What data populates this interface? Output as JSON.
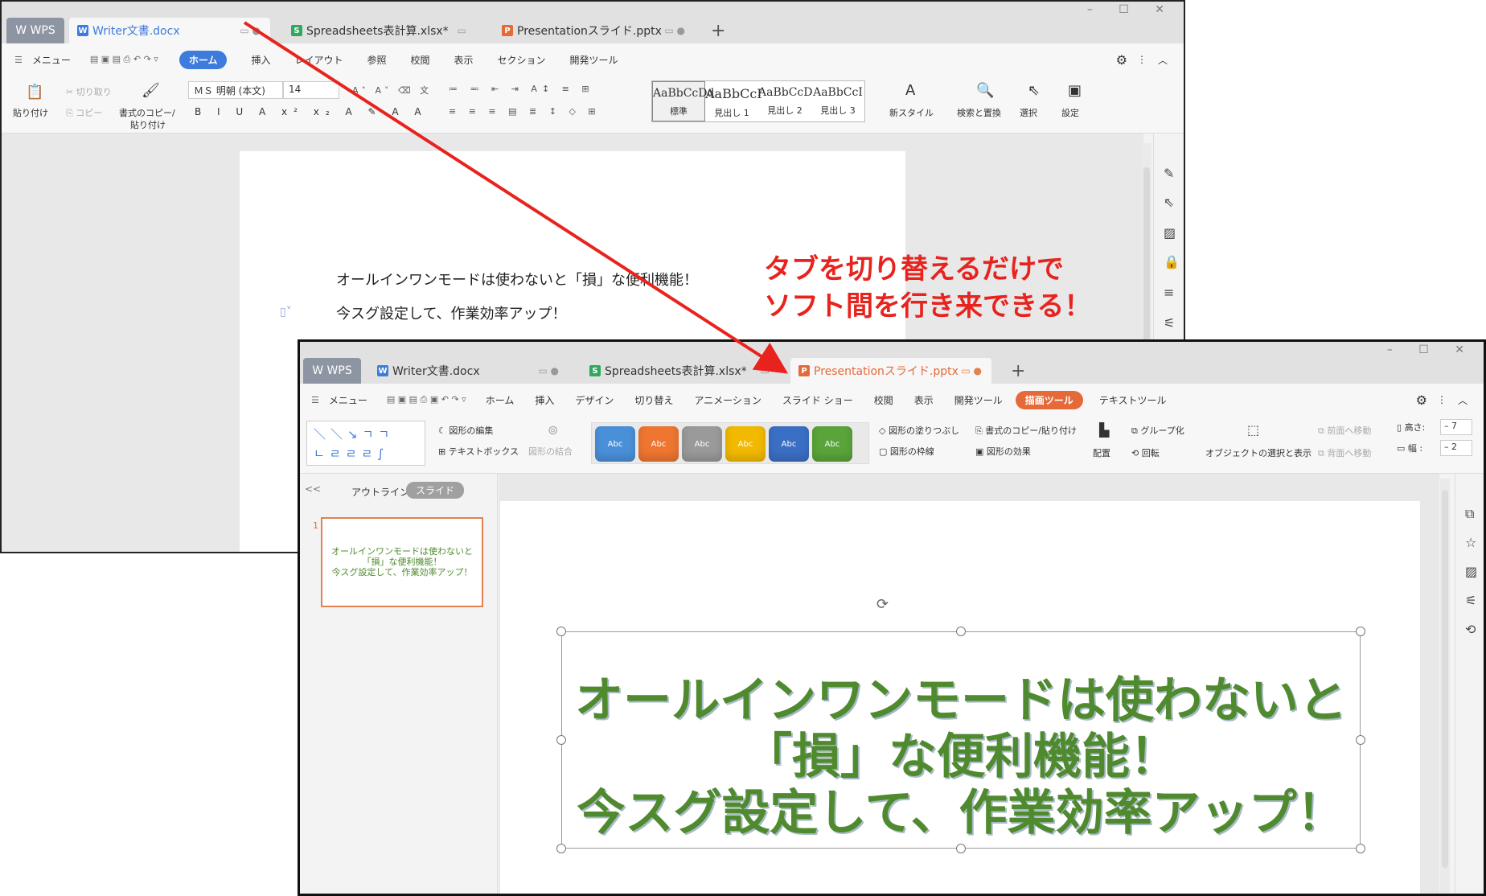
{
  "callout": {
    "line1": "タブを切り替えるだけで",
    "line2": "ソフト間を行き来できる！"
  },
  "writer": {
    "wps_label": "W WPS",
    "tabs": [
      {
        "label": "Writer文書.docx",
        "icon": "W"
      },
      {
        "label": "Spreadsheets表計算.xlsx*",
        "icon": "S"
      },
      {
        "label": "Presentationスライド.pptx",
        "icon": "P"
      }
    ],
    "menu_label": "メニュー",
    "menu": [
      "ホーム",
      "挿入",
      "レイアウト",
      "参照",
      "校閲",
      "表示",
      "セクション",
      "開発ツール"
    ],
    "ribbon": {
      "paste": "貼り付け",
      "cut": "切り取り",
      "copy": "コピー",
      "format_painter_1": "書式のコピー/",
      "format_painter_2": "貼り付け",
      "font_name": "ＭＳ 明朝 (本文)",
      "font_size": "14",
      "styles": [
        {
          "preview": "AaBbCcDd",
          "label": "標準"
        },
        {
          "preview": "AaBbCcI",
          "label": "見出し 1"
        },
        {
          "preview": "AaBbCcD",
          "label": "見出し 2"
        },
        {
          "preview": "AaBbCcI",
          "label": "見出し 3"
        }
      ],
      "new_style": "新スタイル",
      "find_replace": "検索と置換",
      "select": "選択",
      "settings": "設定"
    },
    "doc_lines": [
      "オールインワンモードは使わないと「損」な便利機能！",
      "今スグ設定して、作業効率アップ！"
    ]
  },
  "presentation": {
    "wps_label": "W WPS",
    "tabs": [
      {
        "label": "Writer文書.docx",
        "icon": "W"
      },
      {
        "label": "Spreadsheets表計算.xlsx*",
        "icon": "S"
      },
      {
        "label": "Presentationスライド.pptx",
        "icon": "P"
      }
    ],
    "menu_label": "メニュー",
    "menu": [
      "ホーム",
      "挿入",
      "デザイン",
      "切り替え",
      "アニメーション",
      "スライド ショー",
      "校閲",
      "表示",
      "開発ツール",
      "描画ツール",
      "テキストツール"
    ],
    "ribbon": {
      "edit_shape": "図形の編集",
      "text_box": "テキストボックス",
      "merge_shapes": "図形の結合",
      "shape_style_label": "Abc",
      "fill": "図形の塗りつぶし",
      "outline": "図形の枠線",
      "copy_format": "書式のコピー/貼り付け",
      "effect": "図形の効果",
      "arrange": "配置",
      "group": "グループ化",
      "rotate": "回転",
      "select_pane": "オブジェクトの選択と表示",
      "bring_forward": "前面へ移動",
      "send_backward": "背面へ移動",
      "height_label": "高さ:",
      "width_label": "幅 :",
      "height_value": "7",
      "width_value": "2"
    },
    "panel_tabs": {
      "outline": "アウトライン",
      "slides": "スライド"
    },
    "slide_number": "1",
    "thumb_lines": [
      "オールインワンモードは使わないと",
      "「損」な便利機能！",
      "今スグ設定して、作業効率アップ！"
    ],
    "slide_lines": [
      "オールインワンモードは使わないと",
      "「損」な便利機能！",
      "今スグ設定して、作業効率アップ！"
    ]
  },
  "colors": {
    "callout_red": "#e8231d",
    "slide_text_green": "#4f8a2e",
    "shape_styles": [
      "#4a90d9",
      "#ee7631",
      "#9a9a9a",
      "#f2b900",
      "#3b6fc4",
      "#5aa43b"
    ]
  }
}
